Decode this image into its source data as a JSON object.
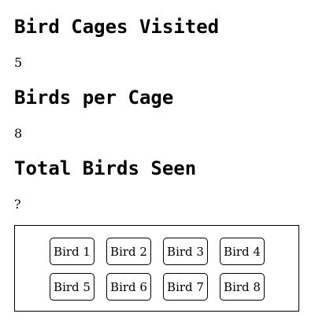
{
  "sections": [
    {
      "heading": "Bird Cages Visited",
      "value": "5"
    },
    {
      "heading": "Birds per Cage",
      "value": "8"
    },
    {
      "heading": "Total Birds Seen",
      "value": "?"
    }
  ],
  "birds": [
    "Bird 1",
    "Bird 2",
    "Bird 3",
    "Bird 4",
    "Bird 5",
    "Bird 6",
    "Bird 7",
    "Bird 8"
  ]
}
